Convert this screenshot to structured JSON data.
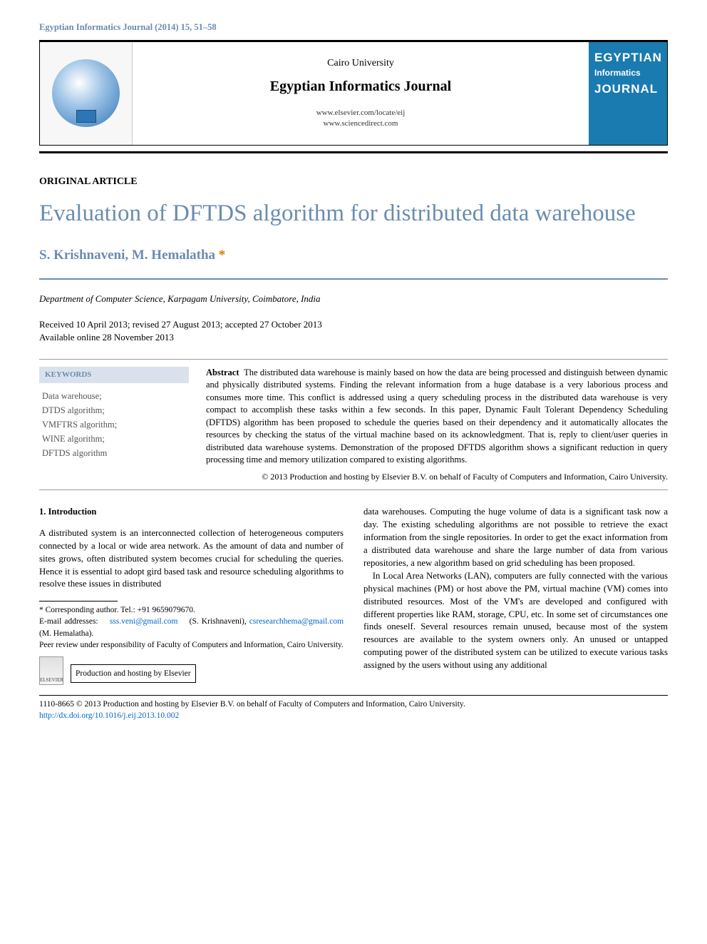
{
  "header_cite": "Egyptian Informatics Journal (2014) 15, 51–58",
  "masthead": {
    "university": "Cairo University",
    "journal": "Egyptian Informatics Journal",
    "url1": "www.elsevier.com/locate/eij",
    "url2": "www.sciencedirect.com",
    "cover_line1": "EGYPTIAN",
    "cover_line2": "Informatics",
    "cover_line3": "JOURNAL"
  },
  "article_type": "ORIGINAL ARTICLE",
  "title": "Evaluation of DFTDS algorithm for distributed data warehouse",
  "authors": "S. Krishnaveni, M. Hemalatha",
  "author_star": "*",
  "affiliation": "Department of Computer Science, Karpagam University, Coimbatore, India",
  "dates_line1": "Received 10 April 2013; revised 27 August 2013; accepted 27 October 2013",
  "dates_line2": "Available online 28 November 2013",
  "keywords_title": "KEYWORDS",
  "keywords": [
    "Data warehouse;",
    "DTDS algorithm;",
    "VMFTRS algorithm;",
    "WINE algorithm;",
    "DFTDS algorithm"
  ],
  "abstract_label": "Abstract",
  "abstract_body": "The distributed data warehouse is mainly based on how the data are being processed and distinguish between dynamic and physically distributed systems. Finding the relevant information from a huge database is a very laborious process and consumes more time. This conflict is addressed using a query scheduling process in the distributed data warehouse is very compact to accomplish these tasks within a few seconds. In this paper, Dynamic Fault Tolerant Dependency Scheduling (DFTDS) algorithm has been proposed to schedule the queries based on their dependency and it automatically allocates the resources by checking the status of the virtual machine based on its acknowledgment. That is, reply to client/user queries in distributed data warehouse systems. Demonstration of the proposed DFTDS algorithm shows a significant reduction in query processing time and memory utilization compared to existing algorithms.",
  "abstract_copyright": "© 2013 Production and hosting by Elsevier B.V. on behalf of Faculty of Computers and Information, Cairo University.",
  "section1_title": "1. Introduction",
  "col1_p1": "A distributed system is an interconnected collection of heterogeneous computers connected by a local or wide area network. As the amount of data and number of sites grows, often distributed system becomes crucial for scheduling the queries. Hence it is essential to adopt gird based task and resource scheduling algorithms to resolve these issues in distributed",
  "col2_p1": "data warehouses. Computing the huge volume of data is a significant task now a day. The existing scheduling algorithms are not possible to retrieve the exact information from the single repositories. In order to get the exact information from a distributed data warehouse and share the large number of data from various repositories, a new algorithm based on grid scheduling has been proposed.",
  "col2_p2": "In Local Area Networks (LAN), computers are fully connected with the various physical machines (PM) or host above the PM, virtual machine (VM) comes into distributed resources. Most of the VM's are developed and configured with different properties like RAM, storage, CPU, etc. In some set of circumstances one finds oneself. Several resources remain unused, because most of the system resources are available to the system owners only. An unused or untapped computing power of the distributed system can be utilized to execute various tasks assigned by the users without using any additional",
  "corr_label": "* Corresponding author. Tel.: +91 9659079670.",
  "email_label": "E-mail addresses:",
  "email1": "sss.veni@gmail.com",
  "email1_name": "(S. Krishnaveni),",
  "email2": "csresearchhema@gmail.com",
  "email2_name": "(M. Hemalatha).",
  "peer_review": "Peer review under responsibility of Faculty of Computers and Information, Cairo University.",
  "hosting_text": "Production and hosting by Elsevier",
  "elsevier_label": "ELSEVIER",
  "footer_issn": "1110-8665 © 2013 Production and hosting by Elsevier B.V. on behalf of Faculty of Computers and Information, Cairo University.",
  "footer_doi": "http://dx.doi.org/10.1016/j.eij.2013.10.002"
}
